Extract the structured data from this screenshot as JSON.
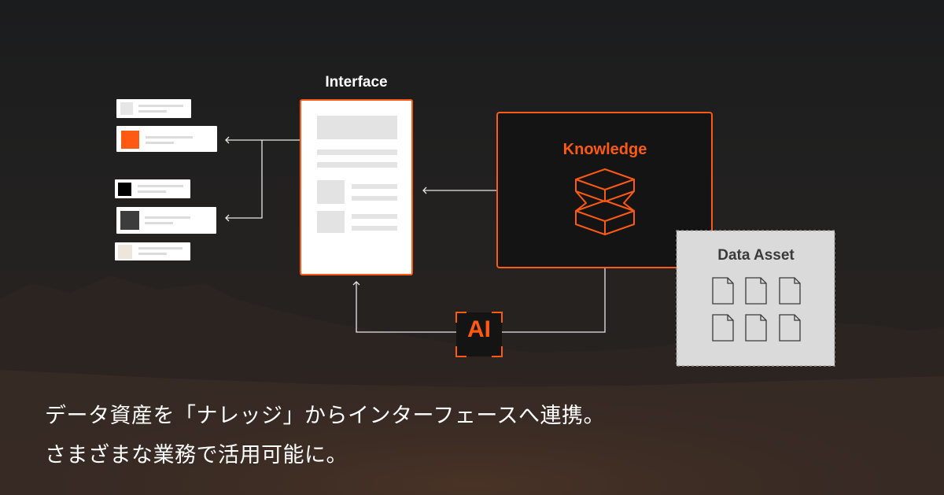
{
  "diagram": {
    "interface_label": "Interface",
    "knowledge_label": "Knowledge",
    "data_asset_label": "Data Asset",
    "ai_label": "AI"
  },
  "caption": {
    "line1": "データ資産を「ナレッジ」からインターフェースへ連携。",
    "line2": "さまざまな業務で活用可能に。"
  },
  "colors": {
    "accent": "#ff5a14",
    "card_swatches": [
      "#e6e6e6",
      "#ff5a14",
      "#000000",
      "#3c3c3c",
      "#eee6da"
    ]
  },
  "icons": {
    "knowledge": "layered-box-icon",
    "data_asset_files": "file-icon",
    "arrows": "chevron-arrow-icon"
  }
}
